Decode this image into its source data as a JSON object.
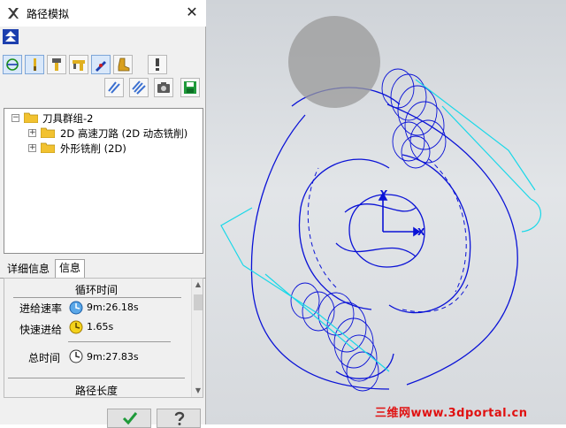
{
  "window": {
    "title": "路径模拟",
    "close_symbol": "✕"
  },
  "toolbar": {
    "row1": [
      {
        "name": "path-display-icon",
        "active": true
      },
      {
        "name": "tool-icon",
        "active": true
      },
      {
        "name": "holder-icon",
        "active": false
      },
      {
        "name": "holder-shank-icon",
        "active": false
      },
      {
        "name": "pen-icon",
        "active": true
      },
      {
        "name": "boot-icon",
        "active": false
      },
      {
        "name": "info-icon",
        "active": false
      }
    ],
    "row2": [
      {
        "name": "toolpath-lines-icon"
      },
      {
        "name": "toolpath-fill-icon"
      },
      {
        "name": "camera-icon"
      },
      {
        "name": "save-icon"
      }
    ]
  },
  "tree": {
    "root": {
      "label": "刀具群组-2",
      "expand_symbol": "−"
    },
    "children": [
      {
        "label": "2D 高速刀路 (2D 动态铣削)",
        "expand_symbol": "+"
      },
      {
        "label": "外形铣削 (2D)",
        "expand_symbol": "+"
      }
    ]
  },
  "tabs": [
    {
      "label": "详细信息",
      "selected": false
    },
    {
      "label": "信息",
      "selected": true
    }
  ],
  "info": {
    "cycle_time_title": "循环时间",
    "feed_rate_label": "进给速率",
    "feed_rate_value": "9m:26.18s",
    "rapid_label": "快速进给",
    "rapid_value": "1.65s",
    "total_label": "总时间",
    "total_value": "9m:27.83s",
    "path_length_title": "路径长度"
  },
  "viewport": {
    "axis_x_label": "X",
    "axis_y_label": "Y",
    "watermark": "三维网www.3dportal.cn",
    "colors": {
      "toolpath": "#0a12d6",
      "rapid": "#19d8e8",
      "tool_sphere": "#9a9a9a"
    }
  }
}
